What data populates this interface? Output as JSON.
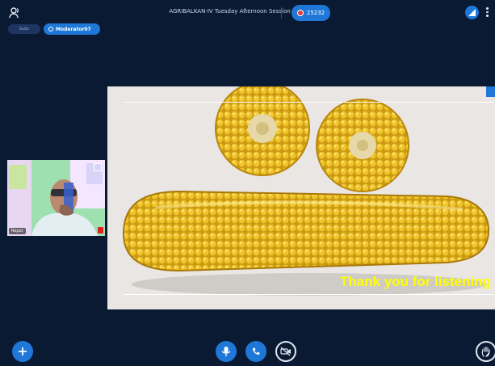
{
  "session": {
    "title": "AGRIBALKAN-IV Tuesday Afternoon Session",
    "timer": "25232"
  },
  "chips": {
    "subc": "Subc",
    "moderator": "Moderator07"
  },
  "webcam": {
    "name": "Repot"
  },
  "slide": {
    "caption": "Thank you for listening"
  },
  "colors": {
    "background": "#0b1a33",
    "accent": "#1f78d8",
    "record": "#e23b3b",
    "caption": "#ffff00"
  },
  "icons": {
    "top_left": "users-icon",
    "top_right": "signal-icon",
    "menu": "more-vertical-icon",
    "add": "plus-icon",
    "mic": "microphone-icon",
    "phone": "phone-icon",
    "camera": "video-camera-off-icon",
    "hand": "raise-hand-icon"
  }
}
